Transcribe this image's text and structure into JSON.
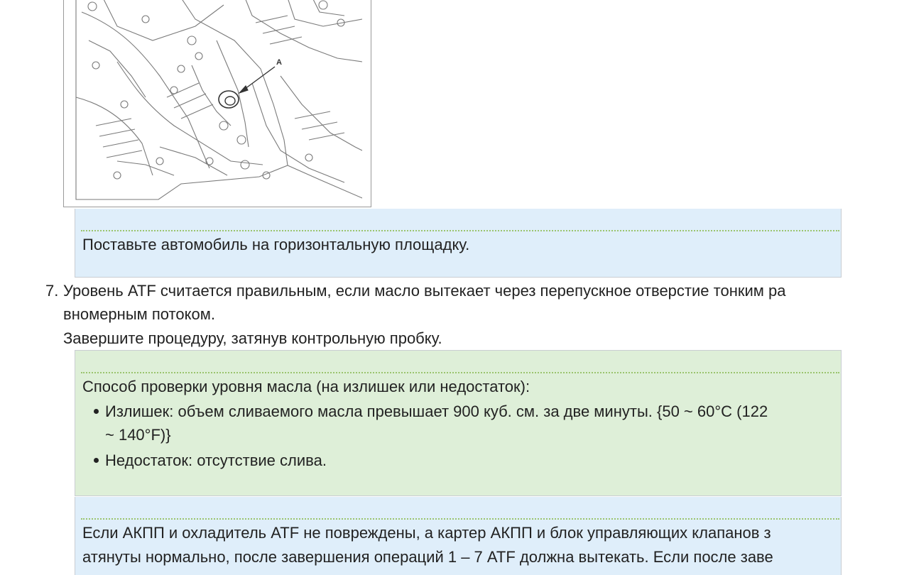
{
  "figure": {
    "callout_label": "A"
  },
  "note1": {
    "text": "Поставьте автомобиль на горизонтальную площадку."
  },
  "step7": {
    "number": "7.",
    "line1": "Уровень ATF считается правильным, если масло вытекает через перепускное отверстие тонким ра",
    "line2": "вномерным потоком.",
    "line3": "Завершите процедуру, затянув контрольную пробку."
  },
  "note2": {
    "title": "Способ проверки уровня масла (на излишек или недостаток):",
    "bullets": [
      {
        "line1": "Излишек: объем сливаемого масла превышает 900 куб. см. за две минуты. {50 ~ 60°C (122",
        "line2": "~ 140°F)}"
      },
      {
        "line1": "Недостаток: отсутствие слива."
      }
    ]
  },
  "note3": {
    "line1": "Если АКПП и охладитель ATF не повреждены, а картер АКПП и блок управляющих клапанов з",
    "line2": "атянуты нормально, после завершения операций 1 – 7 ATF должна вытекать. Если после заве"
  },
  "colors": {
    "note_blue": "#dfeefa",
    "note_green": "#deefd8",
    "dotted_rule": "#9bc46e"
  }
}
